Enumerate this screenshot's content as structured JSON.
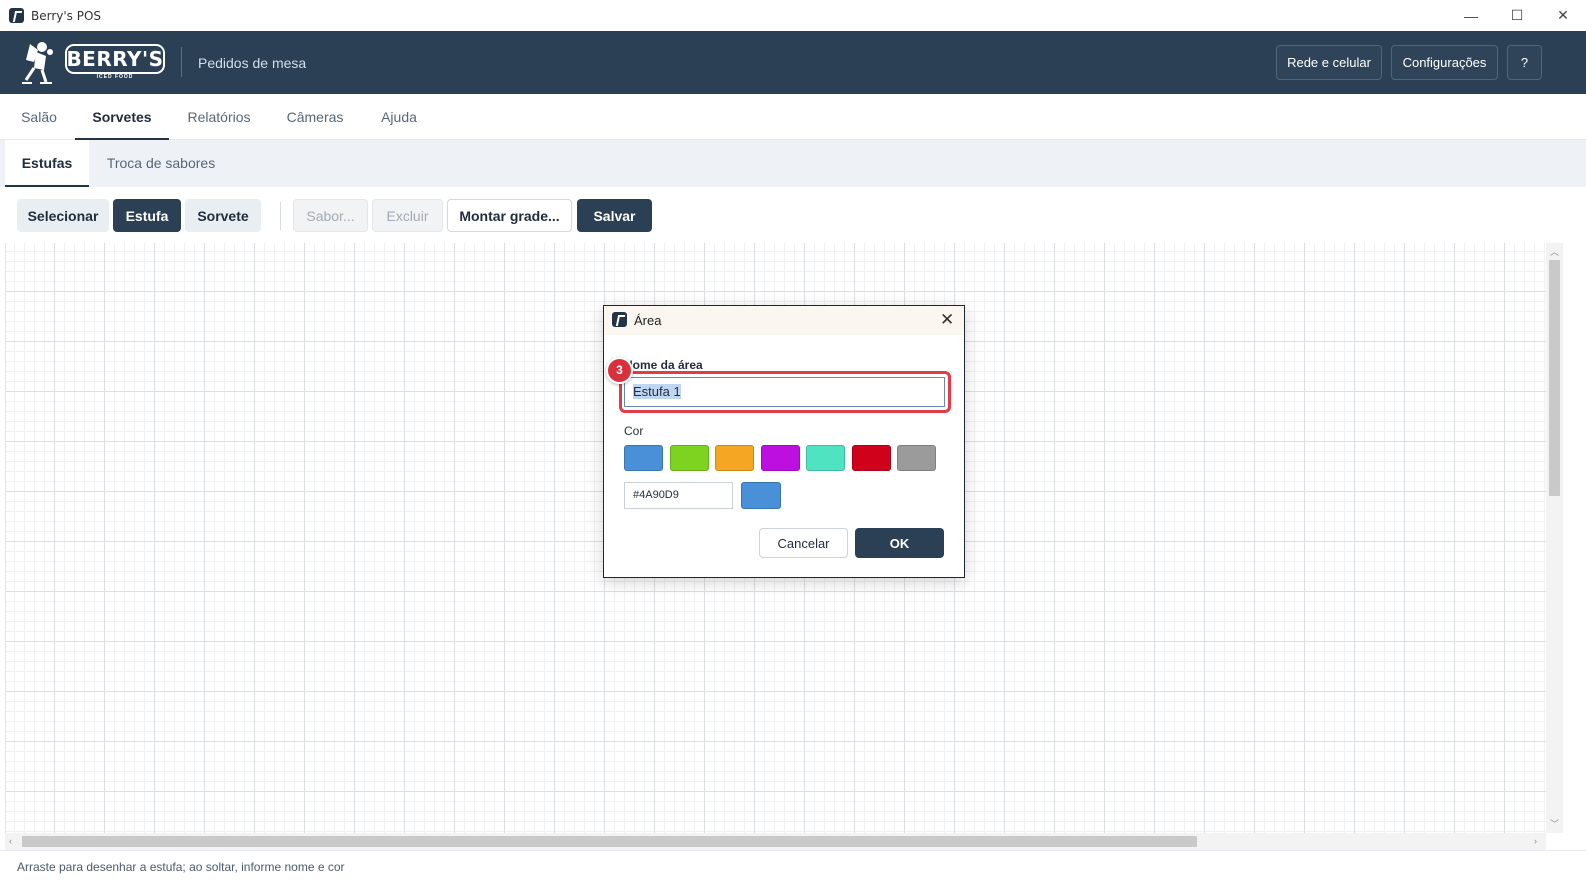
{
  "window": {
    "title": "Berry's POS",
    "controls": {
      "minimize": "—",
      "maximize": "☐",
      "close": "✕"
    }
  },
  "header": {
    "brand": "BERRY'S",
    "brand_sub": "ICED FOOD",
    "subtitle": "Pedidos de mesa",
    "buttons": {
      "network": "Rede e celular",
      "settings": "Configurações",
      "help": "?"
    }
  },
  "main_tabs": [
    "Salão",
    "Sorvetes",
    "Relatórios",
    "Câmeras",
    "Ajuda"
  ],
  "main_tab_active": "Sorvetes",
  "sub_tabs": [
    "Estufas",
    "Troca de sabores"
  ],
  "sub_tab_active": "Estufas",
  "toolbar": {
    "select": "Selecionar",
    "estufa": "Estufa",
    "sorvete": "Sorvete",
    "sabor": "Sabor...",
    "excluir": "Excluir",
    "montar": "Montar grade...",
    "salvar": "Salvar"
  },
  "status": "Arraste para desenhar a estufa; ao soltar, informe nome e cor",
  "dialog": {
    "title": "Área",
    "name_label": "Nome da área",
    "name_value": "Estufa 1",
    "step_badge": "3",
    "color_label": "Cor",
    "swatches": [
      "#4A90D9",
      "#7ED321",
      "#F5A623",
      "#BD10E0",
      "#50E3C2",
      "#D0021B",
      "#9B9B9B"
    ],
    "hex_value": "#4A90D9",
    "preview_color": "#4A90D9",
    "cancel": "Cancelar",
    "ok": "OK"
  }
}
